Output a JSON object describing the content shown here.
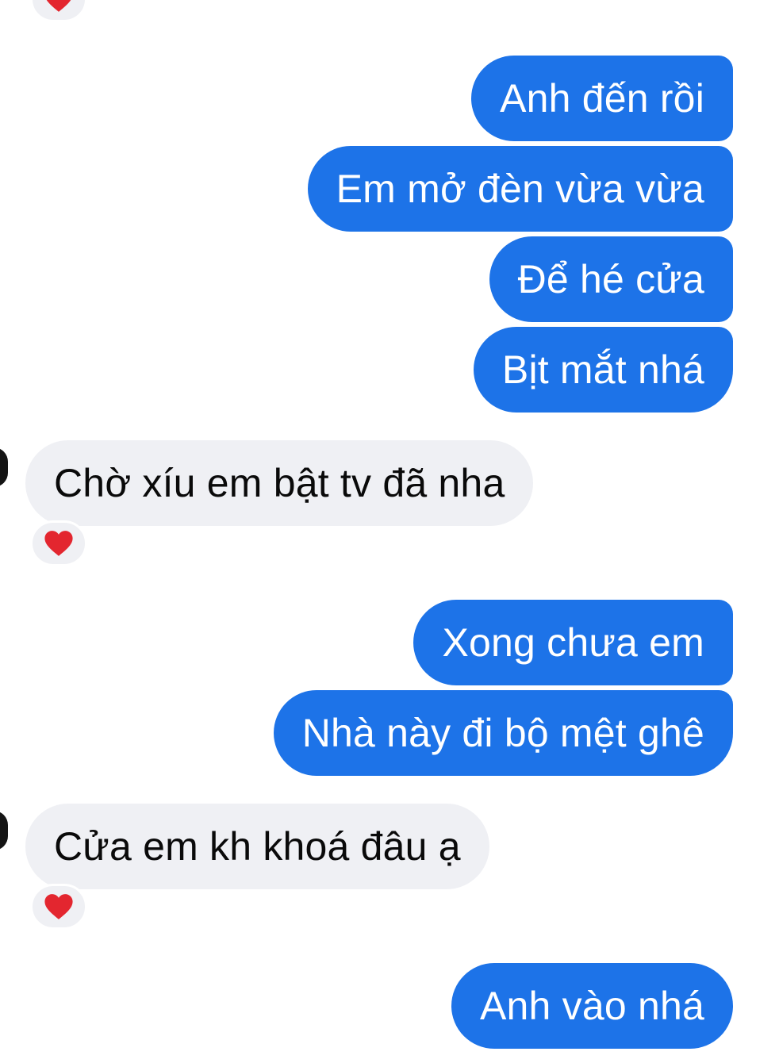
{
  "conversation": {
    "messages": [
      {
        "side": "sent",
        "text": "Anh đến rồi"
      },
      {
        "side": "sent",
        "text": "Em mở đèn vừa vừa"
      },
      {
        "side": "sent",
        "text": "Để hé cửa"
      },
      {
        "side": "sent",
        "text": "Bịt mắt nhá"
      },
      {
        "side": "received",
        "text": "Chờ xíu em bật tv đã nha",
        "reaction": "heart"
      },
      {
        "side": "sent",
        "text": "Xong chưa em"
      },
      {
        "side": "sent",
        "text": "Nhà này đi bộ mệt ghê"
      },
      {
        "side": "received",
        "text": "Cửa em kh khoá đâu ạ",
        "reaction": "heart"
      },
      {
        "side": "sent",
        "text": "Anh vào nhá"
      }
    ]
  },
  "colors": {
    "sent_bubble": "#1d73e8",
    "received_bubble": "#eff0f4",
    "reaction_heart": "#e3262f"
  },
  "icons": {
    "reaction": "heart-icon"
  }
}
